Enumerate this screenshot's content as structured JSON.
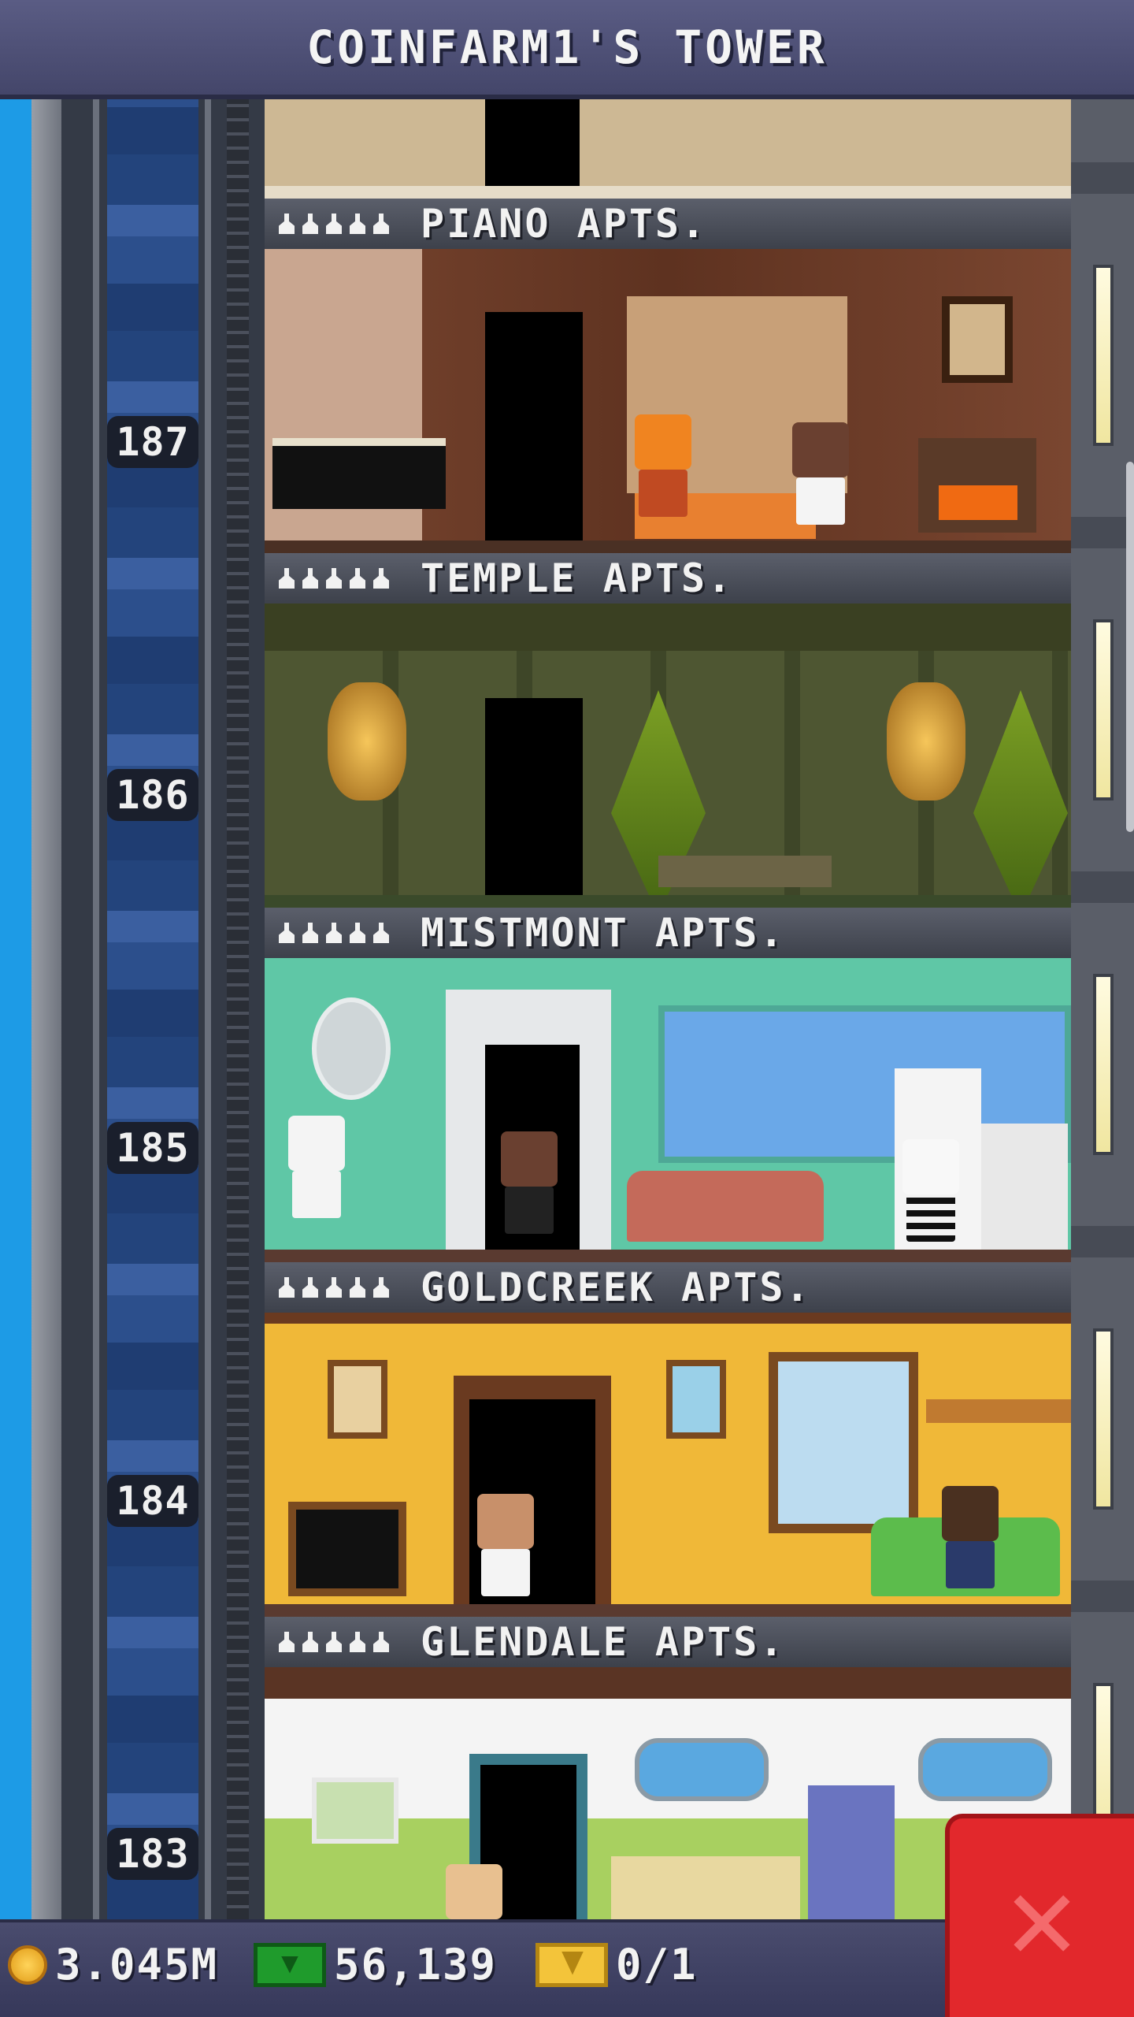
{
  "header": {
    "title": "COINFARM1'S TOWER"
  },
  "floors": [
    {
      "number": "187",
      "name": "PIANO APTS.",
      "stars": 5
    },
    {
      "number": "186",
      "name": "TEMPLE APTS.",
      "stars": 5
    },
    {
      "number": "185",
      "name": "MISTMONT APTS.",
      "stars": 5
    },
    {
      "number": "184",
      "name": "GOLDCREEK APTS.",
      "stars": 5
    },
    {
      "number": "183",
      "name": "GLENDALE APTS.",
      "stars": 5
    }
  ],
  "status": {
    "coins": "3.045M",
    "bux": "56,139",
    "tickets": "0/1"
  },
  "icons": {
    "coin": "coin-icon",
    "bux": "tower-bux-icon",
    "ticket": "golden-ticket-icon",
    "close": "close-icon"
  },
  "colors": {
    "close_button": "#e2282c",
    "piano_wall": "#6a3a26",
    "temple_wall": "#4e5632",
    "mistmont_wall": "#5fc7a6",
    "goldcreek_wall": "#f0b838",
    "glendale_wall": "#f4f4f4"
  }
}
